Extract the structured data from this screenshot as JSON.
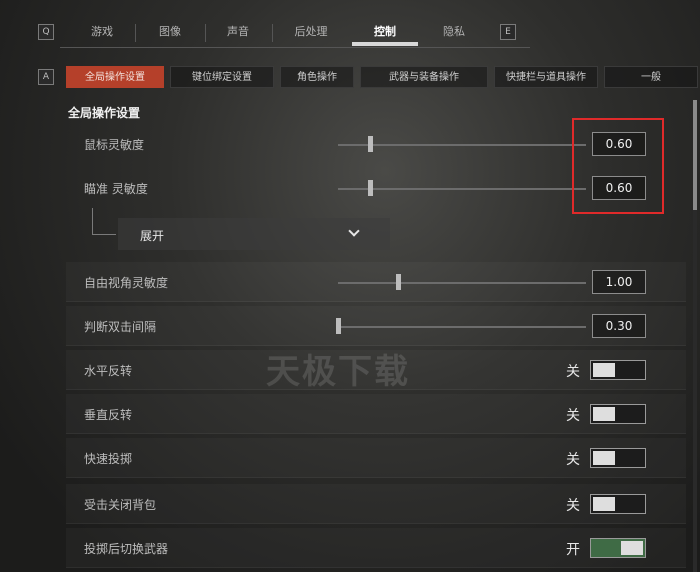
{
  "top_nav": {
    "left_key": "Q",
    "right_key": "E",
    "tabs": [
      {
        "label": "游戏"
      },
      {
        "label": "图像"
      },
      {
        "label": "声音"
      },
      {
        "label": "后处理"
      },
      {
        "label": "控制",
        "active": true
      },
      {
        "label": "隐私"
      }
    ]
  },
  "sub_nav": {
    "left_key": "A",
    "tabs": [
      {
        "label": "全局操作设置",
        "active": true
      },
      {
        "label": "键位绑定设置"
      },
      {
        "label": "角色操作"
      },
      {
        "label": "武器与装备操作"
      },
      {
        "label": "快捷栏与道具操作"
      },
      {
        "label": "一般"
      }
    ]
  },
  "section": {
    "title": "全局操作设置"
  },
  "settings": {
    "mouse_sensitivity": {
      "label": "鼠标灵敏度",
      "value": "0.60",
      "level": 0.13
    },
    "aim_sensitivity": {
      "label": "瞄准 灵敏度",
      "value": "0.60",
      "level": 0.13
    },
    "expand": {
      "label": "展开"
    },
    "freelook_sensitivity": {
      "label": "自由视角灵敏度",
      "value": "1.00",
      "level": 0.24
    },
    "double_click_interval": {
      "label": "判断双击间隔",
      "value": "0.30",
      "level": 0.0
    },
    "horizontal_invert": {
      "label": "水平反转",
      "state": "关",
      "on": false
    },
    "vertical_invert": {
      "label": "垂直反转",
      "state": "关",
      "on": false
    },
    "quick_throw": {
      "label": "快速投掷",
      "state": "关",
      "on": false
    },
    "close_backpack_on_hit": {
      "label": "受击关闭背包",
      "state": "关",
      "on": false
    },
    "switch_weapon_after_throw": {
      "label": "投掷后切换武器",
      "state": "开",
      "on": true
    }
  },
  "watermark": "天极下载",
  "colors": {
    "accent": "#b5402a",
    "highlight": "#e02a2a",
    "toggle_on": "#3f6b45"
  }
}
